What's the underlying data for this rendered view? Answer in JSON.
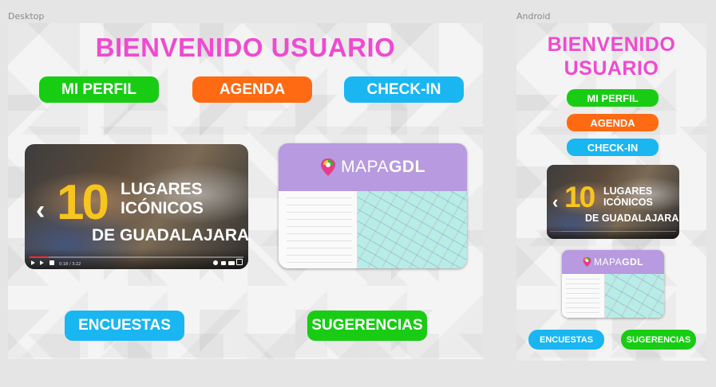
{
  "frames": {
    "desktop_label": "Desktop",
    "android_label": "Android"
  },
  "desktop": {
    "title": "BIENVENIDO USUARIO",
    "buttons": {
      "perfil": "MI PERFIL",
      "agenda": "AGENDA",
      "checkin": "CHECK-IN",
      "encuestas": "ENCUESTAS",
      "sugerencias": "SUGERENCIAS"
    },
    "video": {
      "number": "10",
      "line1": "LUGARES",
      "line2": "ICÓNICOS",
      "line3": "DE GUADALAJARA",
      "time": "0:18 / 3:22",
      "progress": 0.09
    },
    "map": {
      "brand_light": "MAPA",
      "brand_bold": "GDL"
    }
  },
  "android": {
    "title": "BIENVENIDO USUARIO",
    "buttons": {
      "perfil": "MI PERFIL",
      "agenda": "AGENDA",
      "checkin": "CHECK-IN",
      "encuestas": "ENCUESTAS",
      "sugerencias": "SUGERENCIAS"
    },
    "video": {
      "number": "10",
      "line1": "LUGARES",
      "line2": "ICÓNICOS",
      "line3": "DE GUADALAJARA"
    },
    "map": {
      "brand_light": "MAPA",
      "brand_bold": "GDL"
    }
  },
  "colors": {
    "title": "#f04ad1",
    "green": "#18cc14",
    "orange": "#ff6a12",
    "blue": "#1ab6f2",
    "map_header": "#b79ae0"
  }
}
